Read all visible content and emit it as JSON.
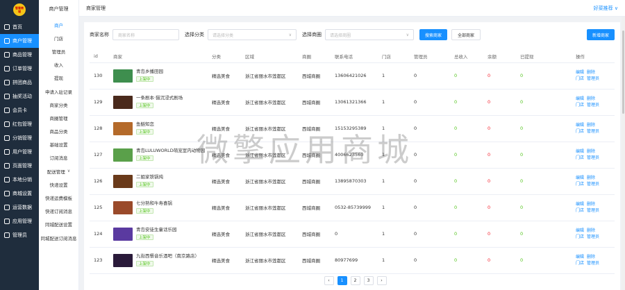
{
  "logo": {
    "text": "智慧商城"
  },
  "sidebar": {
    "items": [
      {
        "label": "首页",
        "icon": "home-icon",
        "active": false
      },
      {
        "label": "商户管理",
        "icon": "store-icon",
        "active": true
      },
      {
        "label": "商品管理",
        "icon": "goods-icon",
        "active": false
      },
      {
        "label": "订单管理",
        "icon": "order-icon",
        "active": false
      },
      {
        "label": "拼团商品",
        "icon": "group-icon",
        "active": false
      },
      {
        "label": "抽奖活动",
        "icon": "lottery-icon",
        "active": false
      },
      {
        "label": "会员卡",
        "icon": "card-icon",
        "active": false
      },
      {
        "label": "红包管理",
        "icon": "redpacket-icon",
        "active": false
      },
      {
        "label": "分销管理",
        "icon": "distribution-icon",
        "active": false
      },
      {
        "label": "用户管理",
        "icon": "user-icon",
        "active": false
      },
      {
        "label": "页面管理",
        "icon": "page-icon",
        "active": false
      },
      {
        "label": "本地分销",
        "icon": "local-icon",
        "active": false
      },
      {
        "label": "商城设置",
        "icon": "settings-icon",
        "active": false
      },
      {
        "label": "运营数据",
        "icon": "data-icon",
        "active": false
      },
      {
        "label": "应用管理",
        "icon": "app-icon",
        "active": false
      },
      {
        "label": "管理员",
        "icon": "admin-icon",
        "active": false
      }
    ]
  },
  "submenu": {
    "title": "商户管理",
    "items": [
      {
        "label": "商户",
        "active": true
      },
      {
        "label": "门店"
      },
      {
        "label": "管理员"
      },
      {
        "label": "收入"
      },
      {
        "label": "提现"
      },
      {
        "label": "申请入驻记录"
      },
      {
        "label": "商家分类"
      },
      {
        "label": "商圈管理"
      },
      {
        "label": "商品分类"
      },
      {
        "label": "基础设置"
      },
      {
        "label": "订阅消息"
      },
      {
        "label": "配送管理",
        "caret": "∨"
      },
      {
        "label": "快递设置"
      },
      {
        "label": "快递运费模板"
      },
      {
        "label": "快递订阅消息"
      },
      {
        "label": "同城配送设置"
      },
      {
        "label": "同城配送订阅消息"
      }
    ]
  },
  "header": {
    "breadcrumb": "商家管理",
    "user": "好菜推荐 ∨"
  },
  "filters": {
    "name_label": "商家名称",
    "name_placeholder": "商家名称",
    "category_label": "选择分类",
    "category_placeholder": "请选择分类",
    "district_label": "选择商圈",
    "district_placeholder": "请选择商圈",
    "search_button": "搜索商家",
    "all_button": "全部商家",
    "new_button": "新增商家"
  },
  "table": {
    "columns": [
      "id",
      "商家",
      "分类",
      "区域",
      "商圈",
      "联系电话",
      "门店",
      "管理员",
      "总收入",
      "余额",
      "已提现",
      "操作"
    ],
    "rows": [
      {
        "id": "130",
        "name": "青岛乡播田园",
        "status": "上架中",
        "category": "精选美食",
        "region": "浙江省丽水市莲都区",
        "district": "西城商圈",
        "phone": "13606421026",
        "stores": "1",
        "admins": "0",
        "income": "0",
        "balance": "0",
        "withdrawn": "0",
        "thumb": "#3e8e4e"
      },
      {
        "id": "129",
        "name": "一条剧本·猫沉浸式剧场",
        "status": "上架中",
        "category": "精选美食",
        "region": "浙江省丽水市莲都区",
        "district": "西城商圈",
        "phone": "13061321366",
        "stores": "1",
        "admins": "0",
        "income": "0",
        "balance": "0",
        "withdrawn": "0",
        "thumb": "#4a2a1c"
      },
      {
        "id": "128",
        "name": "鱼鲢知恋",
        "status": "上架中",
        "category": "精选美食",
        "region": "浙江省丽水市莲都区",
        "district": "西城商圈",
        "phone": "15153295389",
        "stores": "1",
        "admins": "0",
        "income": "0",
        "balance": "0",
        "withdrawn": "0",
        "thumb": "#b46a2a"
      },
      {
        "id": "127",
        "name": "青岛LULUWORLD萌宠室内动物园",
        "status": "上架中",
        "category": "精选美食",
        "region": "浙江省丽水市莲都区",
        "district": "西城商圈",
        "phone": "4006623560",
        "stores": "1",
        "admins": "0",
        "income": "0",
        "balance": "0",
        "withdrawn": "0",
        "thumb": "#5aa04a"
      },
      {
        "id": "126",
        "name": "二姐家铁锅炖",
        "status": "上架中",
        "category": "精选美食",
        "region": "浙江省丽水市莲都区",
        "district": "西城商圈",
        "phone": "13895870303",
        "stores": "1",
        "admins": "0",
        "income": "0",
        "balance": "0",
        "withdrawn": "0",
        "thumb": "#6a3a1a"
      },
      {
        "id": "125",
        "name": "七分熟和牛寿喜锅",
        "status": "上架中",
        "category": "精选美食",
        "region": "浙江省丽水市莲都区",
        "district": "西城商圈",
        "phone": "0532-85739999",
        "stores": "1",
        "admins": "0",
        "income": "0",
        "balance": "0",
        "withdrawn": "0",
        "thumb": "#9a4a2a"
      },
      {
        "id": "124",
        "name": "青岛安徒生童话乐园",
        "status": "上架中",
        "category": "精选美食",
        "region": "浙江省丽水市莲都区",
        "district": "西城商圈",
        "phone": "0",
        "stores": "1",
        "admins": "0",
        "income": "0",
        "balance": "0",
        "withdrawn": "0",
        "thumb": "#5a3aa0"
      },
      {
        "id": "123",
        "name": "九街西餐音乐酒吧（南京路店）",
        "status": "上架中",
        "category": "精选美食",
        "region": "浙江省丽水市莲都区",
        "district": "西城商圈",
        "phone": "80977699",
        "stores": "1",
        "admins": "0",
        "income": "0",
        "balance": "0",
        "withdrawn": "0",
        "thumb": "#2a1a3a"
      }
    ],
    "ops": {
      "edit": "编辑",
      "delete": "删除",
      "store": "门店",
      "admin": "管理员"
    }
  },
  "pagination": {
    "prev": "‹",
    "pages": [
      "1",
      "2",
      "3"
    ],
    "current": "1",
    "next": "›"
  },
  "watermark": "微擎应用商城",
  "colors": {
    "primary": "#1890ff",
    "sidebar": "#1f2d3d",
    "green": "#52c41a",
    "red": "#f5222d"
  }
}
